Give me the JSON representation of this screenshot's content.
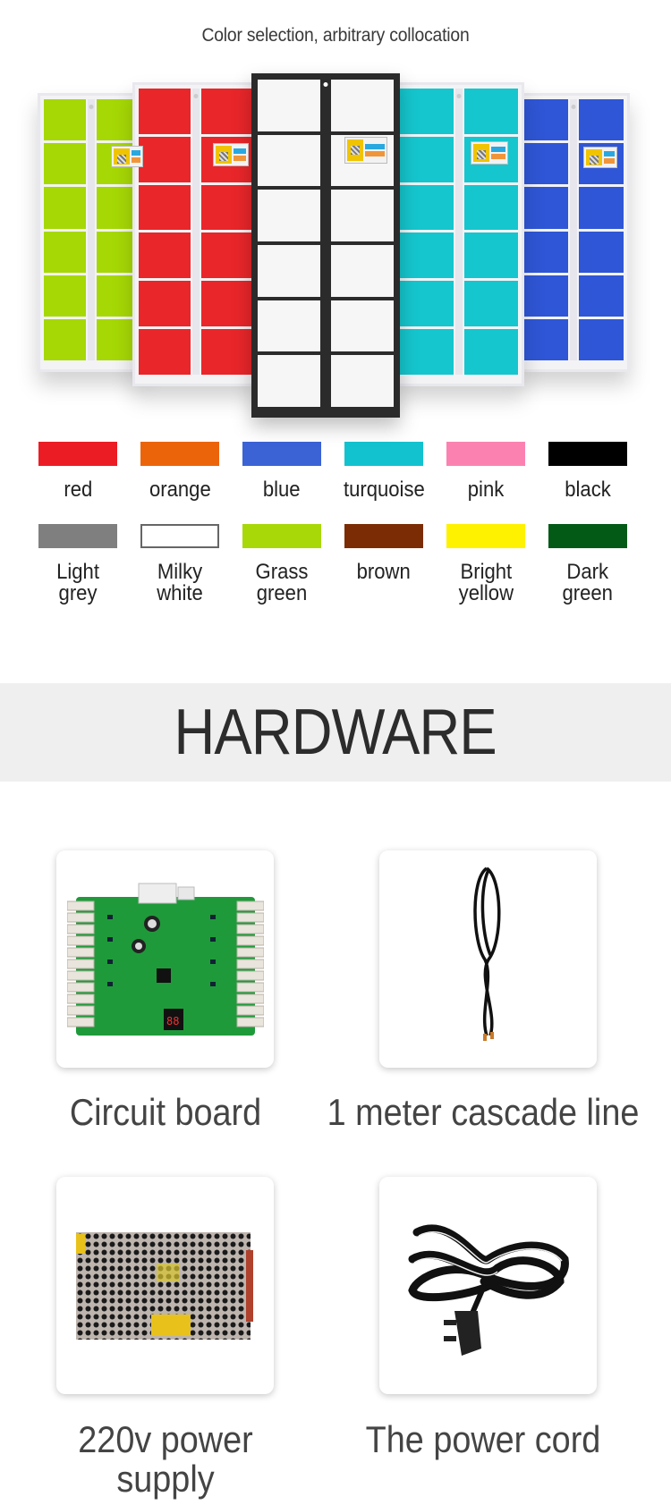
{
  "header": {
    "subtitle": "Color selection, arbitrary collocation"
  },
  "lockers": [
    {
      "name": "grass-green-locker",
      "color": "#a6d805"
    },
    {
      "name": "red-locker",
      "color": "#e9262a"
    },
    {
      "name": "milky-white-locker",
      "color": "#f6f6f6"
    },
    {
      "name": "turquoise-locker",
      "color": "#15c6ce"
    },
    {
      "name": "blue-locker",
      "color": "#2f56d6"
    }
  ],
  "colors": {
    "row1": [
      {
        "label": "red",
        "hex": "#ec1c24"
      },
      {
        "label": "orange",
        "hex": "#ec640a"
      },
      {
        "label": "blue",
        "hex": "#3b63d6"
      },
      {
        "label": "turquoise",
        "hex": "#12c3cf"
      },
      {
        "label": "pink",
        "hex": "#fb82b0"
      },
      {
        "label": "black",
        "hex": "#000000"
      }
    ],
    "row2": [
      {
        "label": "Light\ngrey",
        "hex": "#7f7f7f"
      },
      {
        "label": "Milky\nwhite",
        "hex": "#ffffff"
      },
      {
        "label": "Grass\ngreen",
        "hex": "#a8d808"
      },
      {
        "label": "brown",
        "hex": "#7b2c05"
      },
      {
        "label": "Bright\nyellow",
        "hex": "#fff200"
      },
      {
        "label": "Dark\ngreen",
        "hex": "#035a17"
      }
    ]
  },
  "hardware": {
    "title": "HARDWARE",
    "items": [
      {
        "label": "Circuit board",
        "icon": "circuit-board-image"
      },
      {
        "label": "1 meter cascade line",
        "icon": "cascade-cable-image"
      },
      {
        "label": "220v power\nsupply",
        "icon": "power-supply-image"
      },
      {
        "label": "The power cord",
        "icon": "power-cord-image"
      }
    ]
  }
}
